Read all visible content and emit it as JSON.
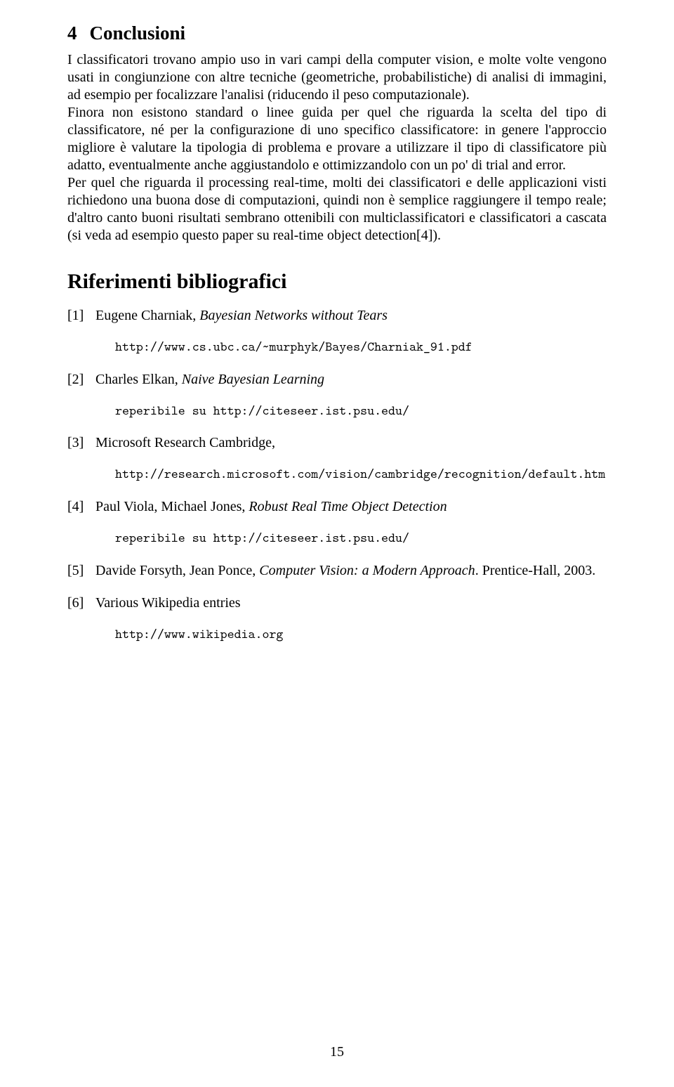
{
  "section": {
    "number": "4",
    "title": "Conclusioni",
    "body": "I classificatori trovano ampio uso in vari campi della computer vision, e molte volte vengono usati in congiunzione con altre tecniche (geometriche, probabilistiche) di analisi di immagini, ad esempio per focalizzare l'analisi (riducendo il peso computazionale).\nFinora non esistono standard o linee guida per quel che riguarda la scelta del tipo di classificatore, né per la configurazione di uno specifico classificatore: in genere l'approccio migliore è valutare la tipologia di problema e provare a utilizzare il tipo di classificatore più adatto, eventualmente anche aggiustandolo e ottimizzandolo con un po' di trial and error.\nPer quel che riguarda il processing real-time, molti dei classificatori e delle applicazioni visti richiedono una buona dose di computazioni, quindi non è semplice raggiungere il tempo reale; d'altro canto buoni risultati sembrano ottenibili con multiclassificatori e classificatori a cascata (si veda ad esempio questo paper su real-time object detection[4])."
  },
  "references": {
    "heading": "Riferimenti bibliografici",
    "items": [
      {
        "marker": "[1]",
        "authors": "Eugene Charniak, ",
        "title_italic": "Bayesian Networks without Tears",
        "rest": "",
        "url": "http://www.cs.ubc.ca/~murphyk/Bayes/Charniak_91.pdf"
      },
      {
        "marker": "[2]",
        "authors": "Charles Elkan, ",
        "title_italic": "Naive Bayesian Learning",
        "rest": "",
        "url": "reperibile su http://citeseer.ist.psu.edu/"
      },
      {
        "marker": "[3]",
        "authors": "Microsoft Research Cambridge,",
        "title_italic": "",
        "rest": "",
        "url": "http://research.microsoft.com/vision/cambridge/recognition/default.htm"
      },
      {
        "marker": "[4]",
        "authors": "Paul Viola, Michael Jones, ",
        "title_italic": "Robust Real Time Object Detection",
        "rest": "",
        "url": "reperibile su http://citeseer.ist.psu.edu/"
      },
      {
        "marker": "[5]",
        "authors": "Davide Forsyth, Jean Ponce, ",
        "title_italic": "Computer Vision: a Modern Approach",
        "rest": ". Prentice-Hall, 2003.",
        "url": ""
      },
      {
        "marker": "[6]",
        "authors": "Various Wikipedia entries",
        "title_italic": "",
        "rest": "",
        "url": "http://www.wikipedia.org"
      }
    ]
  },
  "page_number": "15"
}
